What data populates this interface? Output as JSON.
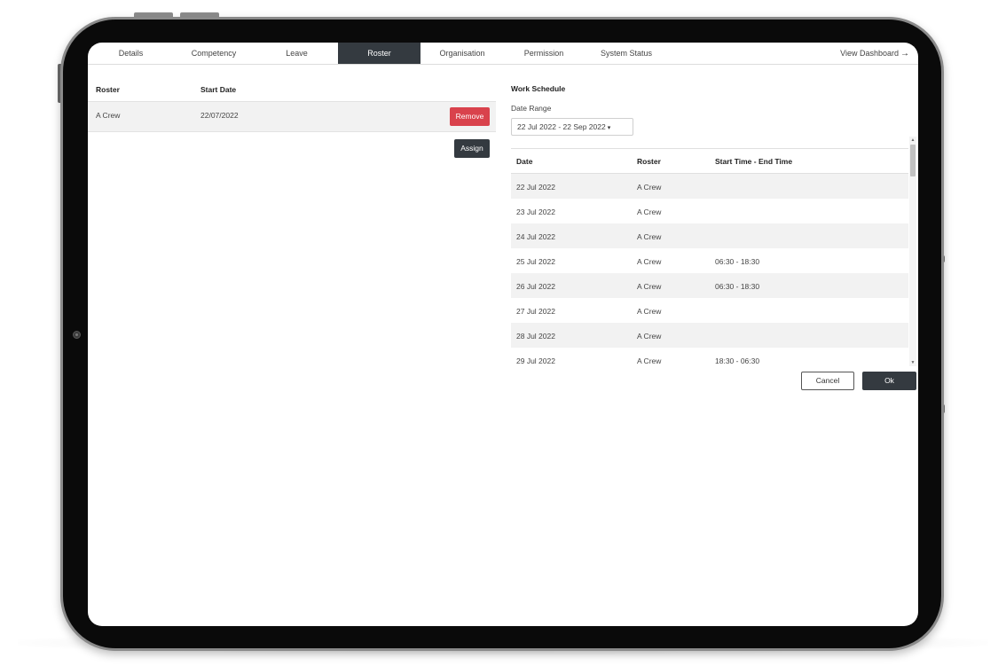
{
  "tabs": [
    {
      "label": "Details"
    },
    {
      "label": "Competency"
    },
    {
      "label": "Leave"
    },
    {
      "label": "Roster"
    },
    {
      "label": "Organisation"
    },
    {
      "label": "Permission"
    },
    {
      "label": "System Status"
    }
  ],
  "active_tab": "Roster",
  "view_dashboard": {
    "label": "View Dashboard",
    "icon": "arrow-right-icon",
    "glyph": "→"
  },
  "roster_table": {
    "headers": {
      "roster": "Roster",
      "start_date": "Start Date"
    },
    "rows": [
      {
        "roster": "A Crew",
        "start_date": "22/07/2022"
      }
    ],
    "remove_label": "Remove",
    "assign_label": "Assign"
  },
  "work_schedule": {
    "title": "Work Schedule",
    "date_range_label": "Date Range",
    "date_range_value": "22 Jul 2022 - 22 Sep 2022",
    "caret_glyph": "▾",
    "headers": {
      "date": "Date",
      "roster": "Roster",
      "time": "Start Time - End Time"
    },
    "rows": [
      {
        "date": "22 Jul 2022",
        "roster": "A Crew",
        "time": ""
      },
      {
        "date": "23 Jul 2022",
        "roster": "A Crew",
        "time": ""
      },
      {
        "date": "24 Jul 2022",
        "roster": "A Crew",
        "time": ""
      },
      {
        "date": "25 Jul 2022",
        "roster": "A Crew",
        "time": "06:30 - 18:30"
      },
      {
        "date": "26 Jul 2022",
        "roster": "A Crew",
        "time": "06:30 - 18:30"
      },
      {
        "date": "27 Jul 2022",
        "roster": "A Crew",
        "time": ""
      },
      {
        "date": "28 Jul 2022",
        "roster": "A Crew",
        "time": ""
      },
      {
        "date": "29 Jul 2022",
        "roster": "A Crew",
        "time": "18:30 - 06:30"
      }
    ]
  },
  "actions": {
    "cancel_label": "Cancel",
    "ok_label": "Ok"
  },
  "colors": {
    "dark": "#343a40",
    "danger": "#d9424c",
    "row_stripe": "#f2f2f2"
  }
}
